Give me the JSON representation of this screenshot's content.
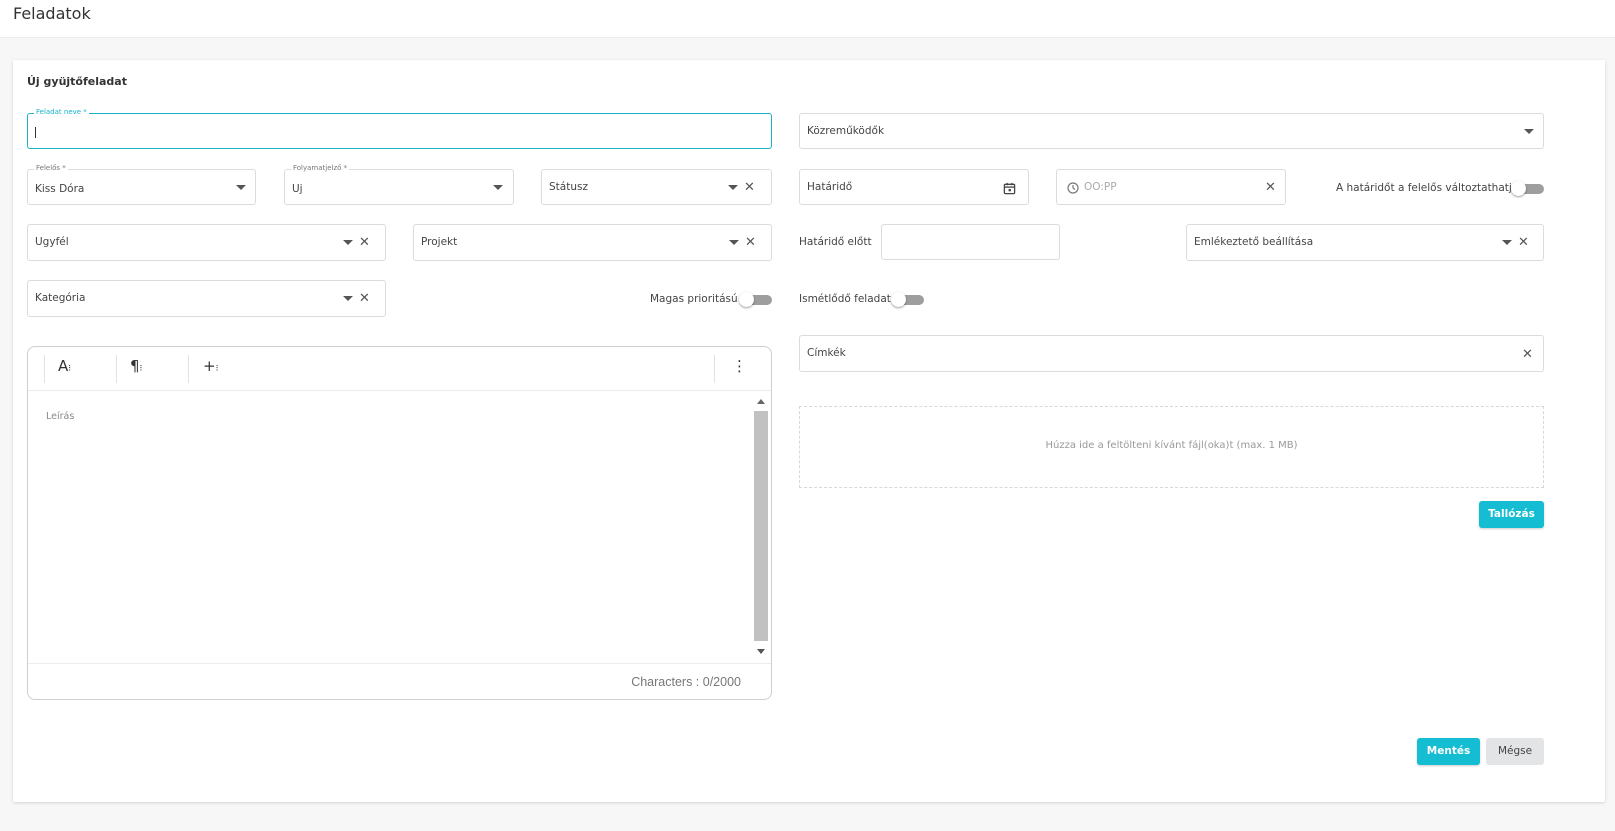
{
  "page": {
    "title": "Feladatok"
  },
  "form": {
    "title": "Új gyüjtőfeladat",
    "task_name": {
      "label": "Feladat neve *",
      "value": ""
    },
    "responsible": {
      "label": "Felelős *",
      "value": "Kiss Dóra"
    },
    "progress": {
      "label": "Folyamatjelző *",
      "value": "Uj"
    },
    "status": {
      "placeholder": "Státusz"
    },
    "client": {
      "placeholder": "Ugyfél"
    },
    "project": {
      "placeholder": "Projekt"
    },
    "category": {
      "placeholder": "Kategória"
    },
    "high_priority": {
      "label": "Magas prioritású",
      "on": false
    },
    "contributors": {
      "placeholder": "Közreműködők"
    },
    "deadline": {
      "placeholder": "Határidő"
    },
    "time": {
      "placeholder": "OO:PP"
    },
    "deadline_changeable": {
      "label": "A határidőt a felelős változtathatja",
      "on": false
    },
    "before_deadline": {
      "label": "Határidő előtt",
      "value": ""
    },
    "reminder": {
      "placeholder": "Emlékeztető beállítása"
    },
    "recurring": {
      "label": "Ismétlődő feladat",
      "on": false
    },
    "tags": {
      "placeholder": "Címkék"
    },
    "dropzone": {
      "text": "Húzza ide a feltölteni kívánt fájl(oka)t (max. 1 MB)"
    },
    "browse_label": "Tallózás",
    "save_label": "Mentés",
    "cancel_label": "Mégse"
  },
  "editor": {
    "toolbar": {
      "text_format": "A",
      "paragraph": "¶",
      "insert": "+",
      "more": "⋮"
    },
    "placeholder": "Leírás",
    "char_counter": "Characters : 0/2000"
  },
  "colors": {
    "accent": "#15bdd3",
    "focus_border": "#19b3c9",
    "toggle_off": "#9e9e9e"
  }
}
